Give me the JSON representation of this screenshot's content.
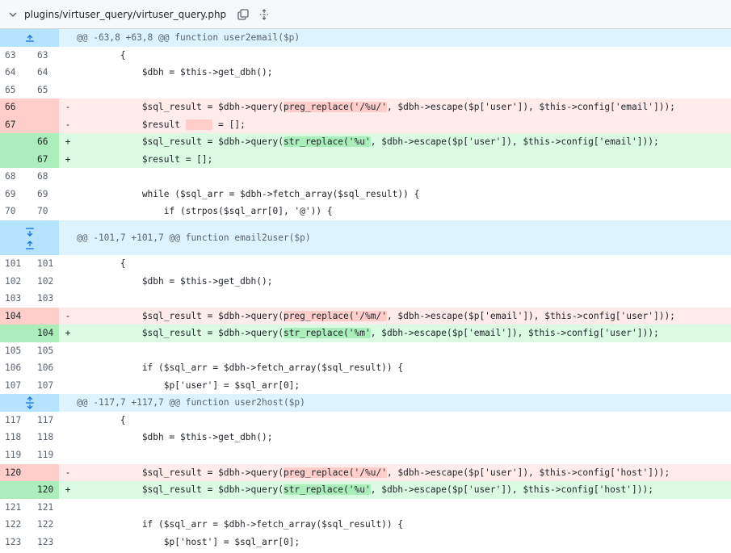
{
  "file": {
    "path": "plugins/virtuser_query/virtuser_query.php",
    "collapse_icon": "chevron-down-icon",
    "copy_icon": "copy-icon",
    "expand_icon": "unfold-icon"
  },
  "hunks": [
    {
      "header": "@@ -63,8 +63,8 @@ function user2email($p)"
    },
    {
      "header": "@@ -101,7 +101,7 @@ function email2user($p)"
    },
    {
      "header": "@@ -117,7 +117,7 @@ function user2host($p)"
    }
  ],
  "lines": {
    "l63": {
      "old": "63",
      "new": "63",
      "text": "        {"
    },
    "l64": {
      "old": "64",
      "new": "64",
      "text": "            $dbh = $this->get_dbh();"
    },
    "l65": {
      "old": "65",
      "new": "65",
      "text": ""
    },
    "d66": {
      "old": "66",
      "new": "",
      "sign": "-",
      "a": "            $sql_result = $dbh->query(",
      "b": "preg_replace('/%u/'",
      "c": ", $dbh->escape($p['user']), $this->config['email']));"
    },
    "d67": {
      "old": "67",
      "new": "",
      "sign": "-",
      "a": "            $result ",
      "b": "     ",
      "c": " = [];"
    },
    "a66": {
      "old": "",
      "new": "66",
      "sign": "+",
      "a": "            $sql_result = $dbh->query(",
      "b": "str_replace('%u'",
      "c": ", $dbh->escape($p['user']), $this->config['email']));"
    },
    "a67": {
      "old": "",
      "new": "67",
      "sign": "+",
      "text": "            $result = [];"
    },
    "l68": {
      "old": "68",
      "new": "68",
      "text": ""
    },
    "l69": {
      "old": "69",
      "new": "69",
      "text": "            while ($sql_arr = $dbh->fetch_array($sql_result)) {"
    },
    "l70": {
      "old": "70",
      "new": "70",
      "text": "                if (strpos($sql_arr[0], '@')) {"
    },
    "l101": {
      "old": "101",
      "new": "101",
      "text": "        {"
    },
    "l102": {
      "old": "102",
      "new": "102",
      "text": "            $dbh = $this->get_dbh();"
    },
    "l103": {
      "old": "103",
      "new": "103",
      "text": ""
    },
    "d104": {
      "old": "104",
      "new": "",
      "sign": "-",
      "a": "            $sql_result = $dbh->query(",
      "b": "preg_replace('/%m/'",
      "c": ", $dbh->escape($p['email']), $this->config['user']));"
    },
    "a104": {
      "old": "",
      "new": "104",
      "sign": "+",
      "a": "            $sql_result = $dbh->query(",
      "b": "str_replace('%m'",
      "c": ", $dbh->escape($p['email']), $this->config['user']));"
    },
    "l105": {
      "old": "105",
      "new": "105",
      "text": ""
    },
    "l106": {
      "old": "106",
      "new": "106",
      "text": "            if ($sql_arr = $dbh->fetch_array($sql_result)) {"
    },
    "l107": {
      "old": "107",
      "new": "107",
      "text": "                $p['user'] = $sql_arr[0];"
    },
    "l117": {
      "old": "117",
      "new": "117",
      "text": "        {"
    },
    "l118": {
      "old": "118",
      "new": "118",
      "text": "            $dbh = $this->get_dbh();"
    },
    "l119": {
      "old": "119",
      "new": "119",
      "text": ""
    },
    "d120": {
      "old": "120",
      "new": "",
      "sign": "-",
      "a": "            $sql_result = $dbh->query(",
      "b": "preg_replace('/%u/'",
      "c": ", $dbh->escape($p['user']), $this->config['host']));"
    },
    "a120": {
      "old": "",
      "new": "120",
      "sign": "+",
      "a": "            $sql_result = $dbh->query(",
      "b": "str_replace('%u'",
      "c": ", $dbh->escape($p['user']), $this->config['host']));"
    },
    "l121": {
      "old": "121",
      "new": "121",
      "text": ""
    },
    "l122": {
      "old": "122",
      "new": "122",
      "text": "            if ($sql_arr = $dbh->fetch_array($sql_result)) {"
    },
    "l123": {
      "old": "123",
      "new": "123",
      "text": "                $p['host'] = $sql_arr[0];"
    }
  }
}
